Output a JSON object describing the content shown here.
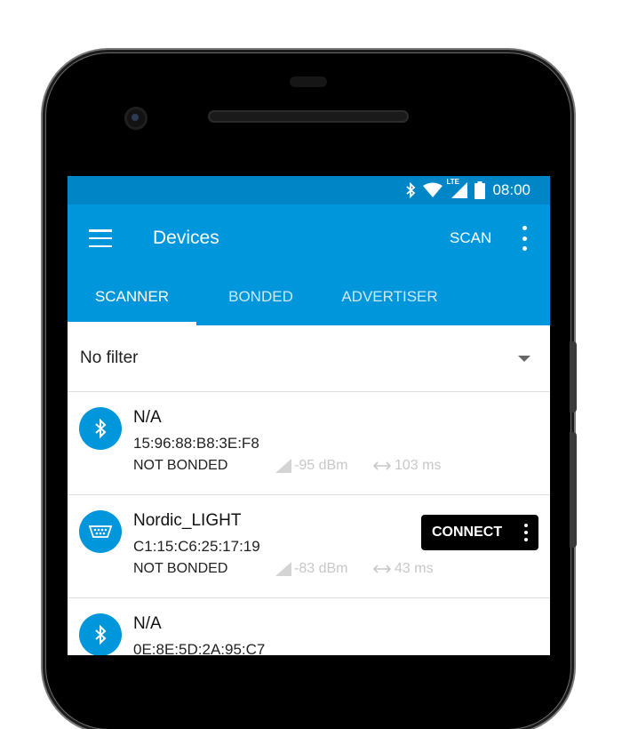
{
  "status_bar": {
    "time": "08:00",
    "icons": [
      "bluetooth-icon",
      "wifi-icon",
      "lte-signal-icon",
      "battery-icon"
    ],
    "lte_label": "LTE"
  },
  "app_bar": {
    "title": "Devices",
    "scan_label": "SCAN"
  },
  "tabs": [
    {
      "label": "SCANNER",
      "active": true
    },
    {
      "label": "BONDED",
      "active": false
    },
    {
      "label": "ADVERTISER",
      "active": false
    }
  ],
  "filter": {
    "selected": "No filter"
  },
  "devices": [
    {
      "name": "N/A",
      "address": "15:96:88:B8:3E:F8",
      "bond": "NOT BONDED",
      "rssi": "-95 dBm",
      "interval": "103 ms",
      "icon": "bluetooth-icon",
      "connectable": false
    },
    {
      "name": "Nordic_LIGHT",
      "address": "C1:15:C6:25:17:19",
      "bond": "NOT BONDED",
      "rssi": "-83 dBm",
      "interval": "43 ms",
      "icon": "serial-port-icon",
      "connectable": true,
      "connect_label": "CONNECT"
    },
    {
      "name": "N/A",
      "address": "0E:8E:5D:2A:95:C7",
      "icon": "bluetooth-icon",
      "connectable": false
    }
  ],
  "colors": {
    "primary": "#0096db",
    "primary_dark": "#0085c6",
    "connect_button": "#000000"
  }
}
